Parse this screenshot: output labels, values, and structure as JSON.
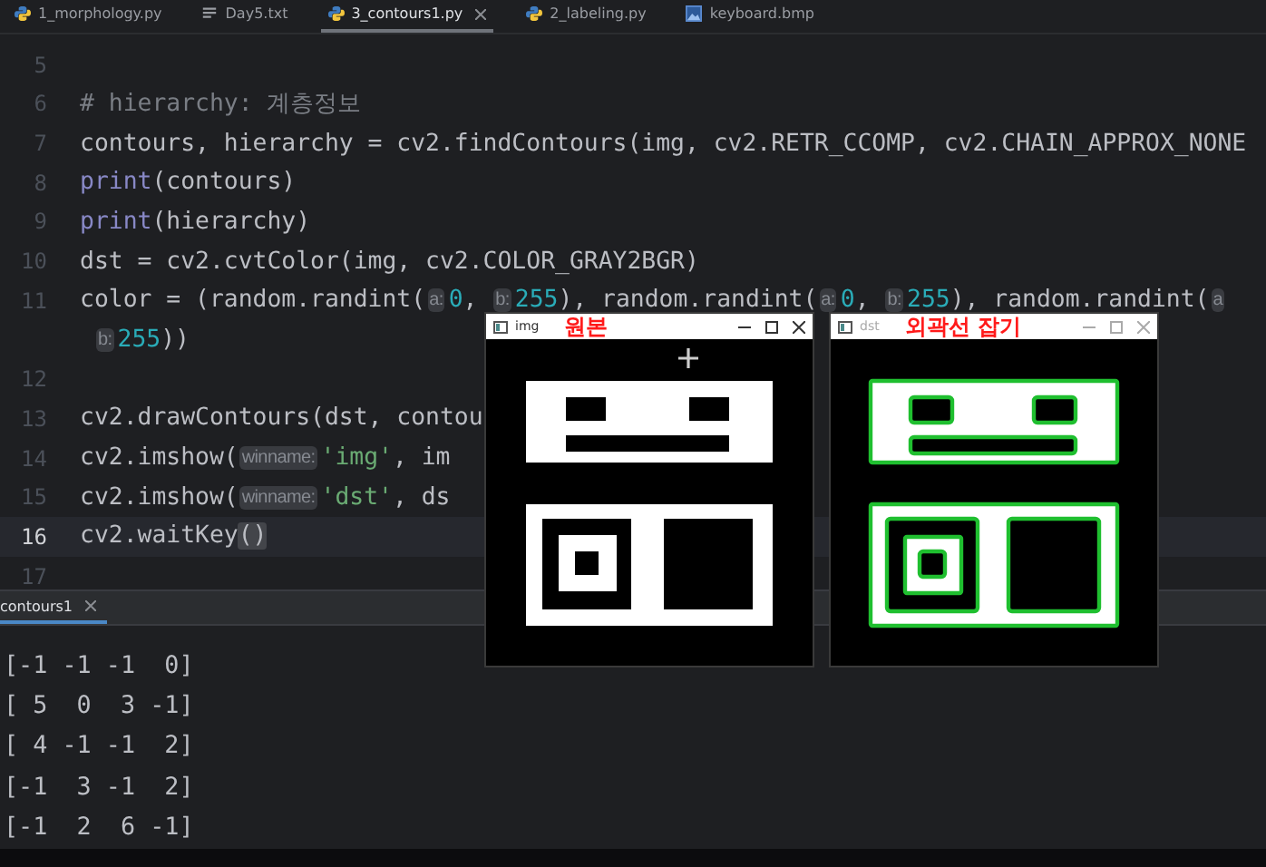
{
  "tabs": [
    {
      "label": "1_morphology.py",
      "kind": "python",
      "selected": false,
      "closable": false
    },
    {
      "label": "Day5.txt",
      "kind": "text",
      "selected": false,
      "closable": false
    },
    {
      "label": "3_contours1.py",
      "kind": "python",
      "selected": true,
      "closable": true
    },
    {
      "label": "2_labeling.py",
      "kind": "python",
      "selected": false,
      "closable": false
    },
    {
      "label": "keyboard.bmp",
      "kind": "image",
      "selected": false,
      "closable": false
    }
  ],
  "editor": {
    "lines": [
      {
        "number": "5",
        "current": false
      },
      {
        "number": "6",
        "current": false,
        "tokens": [
          {
            "kind": "comment",
            "text": "# hierarchy: 계층정보"
          }
        ]
      },
      {
        "number": "7",
        "current": false,
        "tokens": [
          {
            "kind": "plain",
            "text": "contours, hierarchy = cv2.findContours(img, cv2.RETR_CCOMP, cv2.CHAIN_APPROX_NONE"
          }
        ]
      },
      {
        "number": "8",
        "current": false,
        "tokens": [
          {
            "kind": "builtin",
            "text": "print"
          },
          {
            "kind": "plain",
            "text": "(contours)"
          }
        ]
      },
      {
        "number": "9",
        "current": false,
        "tokens": [
          {
            "kind": "builtin",
            "text": "print"
          },
          {
            "kind": "plain",
            "text": "(hierarchy)"
          }
        ]
      },
      {
        "number": "10",
        "current": false,
        "tokens": [
          {
            "kind": "plain",
            "text": "dst = cv2.cvtColor(img, cv2.COLOR_GRAY2BGR)"
          }
        ]
      },
      {
        "number": "11",
        "current": false,
        "tokens": [
          {
            "kind": "plain",
            "text": "color = (random.randint("
          },
          {
            "kind": "hint",
            "text": "a:"
          },
          {
            "kind": "number",
            "text": "0"
          },
          {
            "kind": "plain",
            "text": ", "
          },
          {
            "kind": "hint",
            "text": "b:"
          },
          {
            "kind": "number",
            "text": "255"
          },
          {
            "kind": "plain",
            "text": "), random.randint("
          },
          {
            "kind": "hint",
            "text": "a:"
          },
          {
            "kind": "number",
            "text": "0"
          },
          {
            "kind": "plain",
            "text": ", "
          },
          {
            "kind": "hint",
            "text": "b:"
          },
          {
            "kind": "number",
            "text": "255"
          },
          {
            "kind": "plain",
            "text": "), random.randint("
          },
          {
            "kind": "hint",
            "text": "a"
          }
        ],
        "wrap": [
          {
            "kind": "hint",
            "text": "b:"
          },
          {
            "kind": "number",
            "text": "255"
          },
          {
            "kind": "plain",
            "text": "))"
          }
        ]
      },
      {
        "number": "12",
        "current": false
      },
      {
        "number": "13",
        "current": false,
        "tokens": [
          {
            "kind": "plain",
            "text": "cv2.drawContours(dst, contou"
          }
        ]
      },
      {
        "number": "14",
        "current": false,
        "tokens": [
          {
            "kind": "plain",
            "text": "cv2.imshow("
          },
          {
            "kind": "hint",
            "text": "winname:"
          },
          {
            "kind": "string",
            "text": "'img'"
          },
          {
            "kind": "plain",
            "text": ", im"
          }
        ]
      },
      {
        "number": "15",
        "current": false,
        "tokens": [
          {
            "kind": "plain",
            "text": "cv2.imshow("
          },
          {
            "kind": "hint",
            "text": "winname:"
          },
          {
            "kind": "string",
            "text": "'dst'"
          },
          {
            "kind": "plain",
            "text": ", ds"
          }
        ]
      },
      {
        "number": "16",
        "current": true,
        "tokens": [
          {
            "kind": "plain",
            "text": "cv2.waitKey"
          },
          {
            "kind": "match",
            "text": "()"
          }
        ]
      },
      {
        "number": "17",
        "current": false
      }
    ]
  },
  "run_panel": {
    "tab": {
      "label": "contours1",
      "selected": true
    },
    "output": [
      "[-1 -1 -1  0]",
      "[ 5  0  3 -1]",
      "[ 4 -1 -1  2]",
      "[-1  3 -1  2]",
      "[-1  2  6 -1]"
    ]
  },
  "windows": [
    {
      "title": "img",
      "annotation": "원본",
      "active": true,
      "kind": "original"
    },
    {
      "title": "dst",
      "annotation": "외곽선 잡기",
      "active": false,
      "kind": "contours"
    }
  ]
}
